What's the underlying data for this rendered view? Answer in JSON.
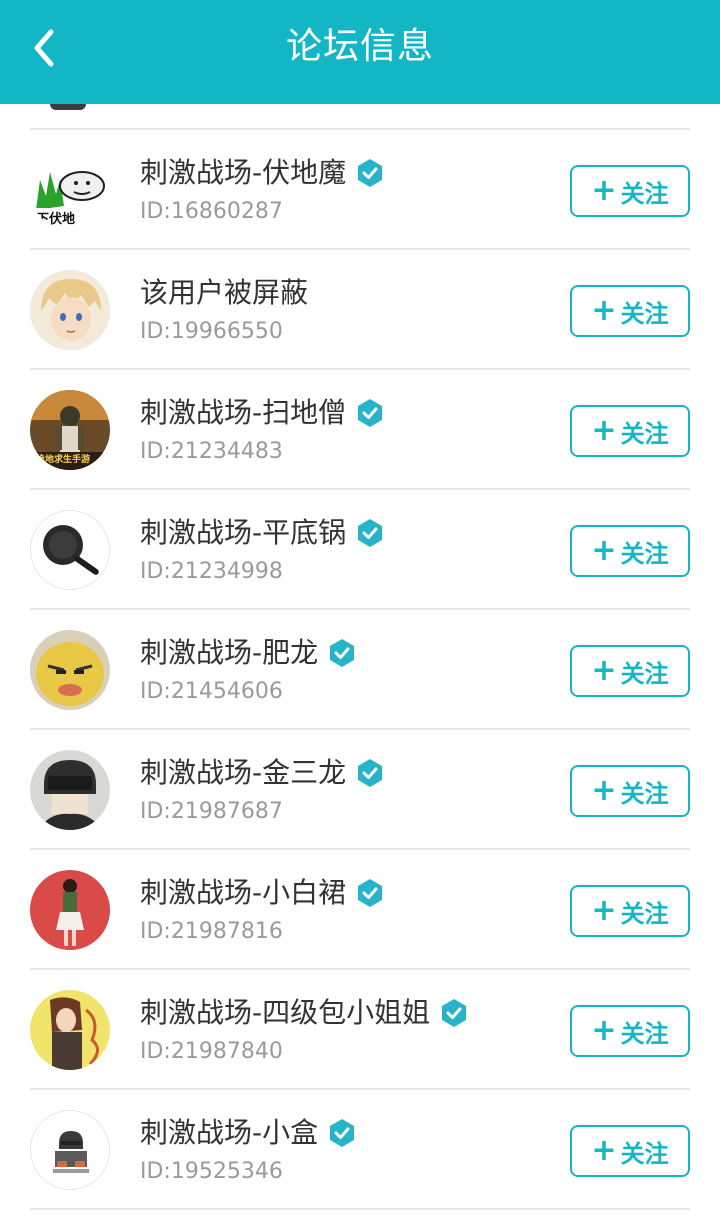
{
  "header": {
    "title": "论坛信息",
    "back_icon": "chevron-left-icon"
  },
  "colors": {
    "primary": "#13b6c4",
    "verified": "#28b4c8",
    "name_text": "#333333",
    "id_text": "#9a9a9a",
    "divider": "#e8e8e8"
  },
  "follow_label": "关注",
  "follow_icon": "plus-icon",
  "verified_icon": "verified-badge-icon",
  "users": [
    {
      "name": "刺激战场-伏地魔",
      "id": "ID:16860287",
      "verified": true,
      "avatar_text": "下伏地"
    },
    {
      "name": "该用户被屏蔽",
      "id": "ID:19966550",
      "verified": false
    },
    {
      "name": "刺激战场-扫地僧",
      "id": "ID:21234483",
      "verified": true,
      "avatar_text": "绝地求生手游"
    },
    {
      "name": "刺激战场-平底锅",
      "id": "ID:21234998",
      "verified": true
    },
    {
      "name": "刺激战场-肥龙",
      "id": "ID:21454606",
      "verified": true
    },
    {
      "name": "刺激战场-金三龙",
      "id": "ID:21987687",
      "verified": true
    },
    {
      "name": "刺激战场-小白裙",
      "id": "ID:21987816",
      "verified": true
    },
    {
      "name": "刺激战场-四级包小姐姐",
      "id": "ID:21987840",
      "verified": true
    },
    {
      "name": "刺激战场-小盒",
      "id": "ID:19525346",
      "verified": true
    }
  ]
}
